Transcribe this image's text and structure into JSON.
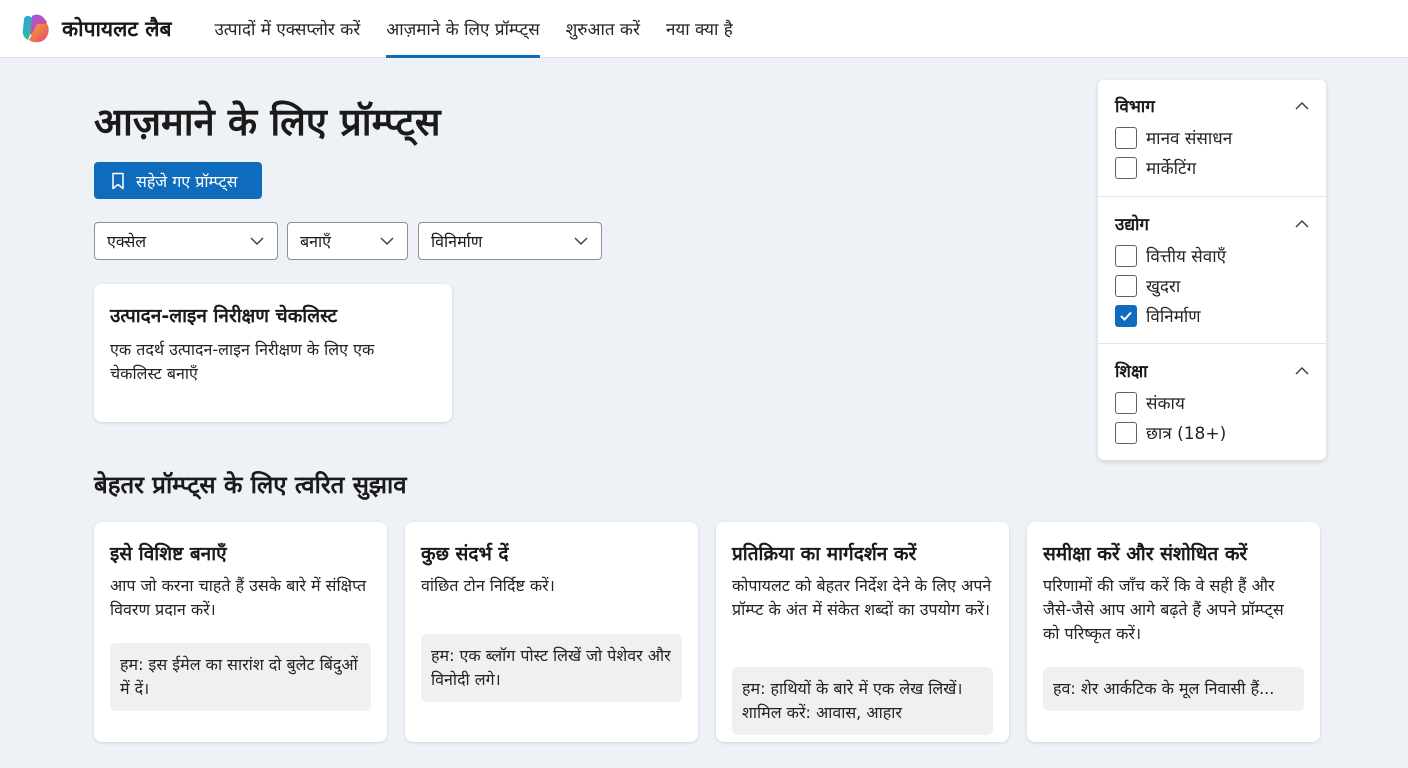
{
  "colors": {
    "accent": "#0f6cbd",
    "page_bg": "#eef2f7"
  },
  "nav": {
    "brand": "कोपायलट लैब",
    "links": [
      {
        "label": "उत्पादों में एक्सप्लोर करें",
        "active": false
      },
      {
        "label": "आज़माने के लिए प्रॉम्प्ट्स",
        "active": true
      },
      {
        "label": "शुरुआत करें",
        "active": false
      },
      {
        "label": "नया क्या है",
        "active": false
      }
    ]
  },
  "page": {
    "title": "आज़माने के लिए प्रॉम्प्ट्स",
    "saved_button": "सहेजे गए प्रॉम्प्ट्स",
    "saved_icon": "bookmark-icon"
  },
  "filters": {
    "app": "एक्सेल",
    "action": "बनाएँ",
    "industry": "विनिर्माण"
  },
  "prompt_card": {
    "title": "उत्पादन-लाइन निरीक्षण चेकलिस्ट",
    "description": "एक तदर्थ उत्पादन-लाइन निरीक्षण के लिए एक चेकलिस्ट बनाएँ"
  },
  "tips": {
    "title": "बेहतर प्रॉम्प्ट्स के लिए त्वरित सुझाव",
    "cards": [
      {
        "title": "इसे विशिष्ट बनाएँ",
        "desc": "आप जो करना चाहते हैं उसके बारे में संक्षिप्त विवरण प्रदान करें।",
        "example": "हम: इस ईमेल का सारांश दो बुलेट बिंदुओं में दें।"
      },
      {
        "title": "कुछ संदर्भ दें",
        "desc": "वांछित टोन निर्दिष्ट करें।",
        "example": "हम: एक ब्लॉग पोस्ट लिखें जो पेशेवर और विनोदी लगे।"
      },
      {
        "title": "प्रतिक्रिया का मार्गदर्शन करें",
        "desc": "कोपायलट को बेहतर निर्देश देने के लिए अपने प्रॉम्प्ट के अंत में संकेत शब्दों का उपयोग करें।",
        "example": "हम: हाथियों के बारे में एक लेख लिखें। शामिल करें: आवास, आहार"
      },
      {
        "title": "समीक्षा करें और संशोधित करें",
        "desc": "परिणामों की जाँच करें कि वे सही हैं और जैसे-जैसे आप आगे बढ़ते हैं अपने प्रॉम्प्ट्स को परिष्कृत करें।",
        "example": "हव: शेर आर्कटिक के मूल निवासी हैं..."
      }
    ]
  },
  "filter_panel": {
    "sections": [
      {
        "heading": "विभाग",
        "options": [
          {
            "label": "मानव संसाधन",
            "checked": false
          },
          {
            "label": "मार्केटिंग",
            "checked": false
          }
        ]
      },
      {
        "heading": "उद्योग",
        "options": [
          {
            "label": "वित्तीय सेवाएँ",
            "checked": false
          },
          {
            "label": "खुदरा",
            "checked": false
          },
          {
            "label": "विनिर्माण",
            "checked": true
          }
        ]
      },
      {
        "heading": "शिक्षा",
        "options": [
          {
            "label": "संकाय",
            "checked": false
          },
          {
            "label": "छात्र (18+)",
            "checked": false
          }
        ]
      }
    ]
  }
}
